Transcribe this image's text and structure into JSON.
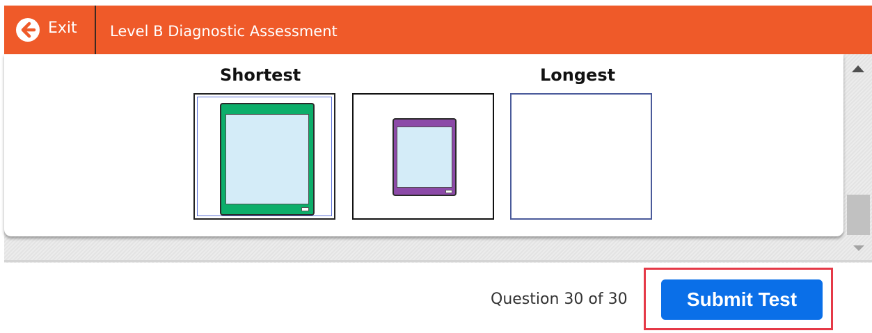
{
  "header": {
    "exit_label": "Exit",
    "exit_icon": "arrow-left-circle-icon",
    "title": "Level B Diagnostic Assessment"
  },
  "question": {
    "shortest_label": "Shortest",
    "longest_label": "Longest",
    "slots": [
      {
        "content": "green tablet"
      },
      {
        "content": "purple tablet"
      },
      {
        "content": "empty"
      }
    ]
  },
  "footer": {
    "question_counter": "Question 30 of 30",
    "submit_label": "Submit Test"
  },
  "colors": {
    "header_background": "#ef5a29",
    "submit_button": "#0a6fe8",
    "highlight_border": "#e53947",
    "green_tablet": "#0cae6a",
    "purple_tablet": "#8c4aa8",
    "tablet_screen": "#d4ecf8"
  }
}
